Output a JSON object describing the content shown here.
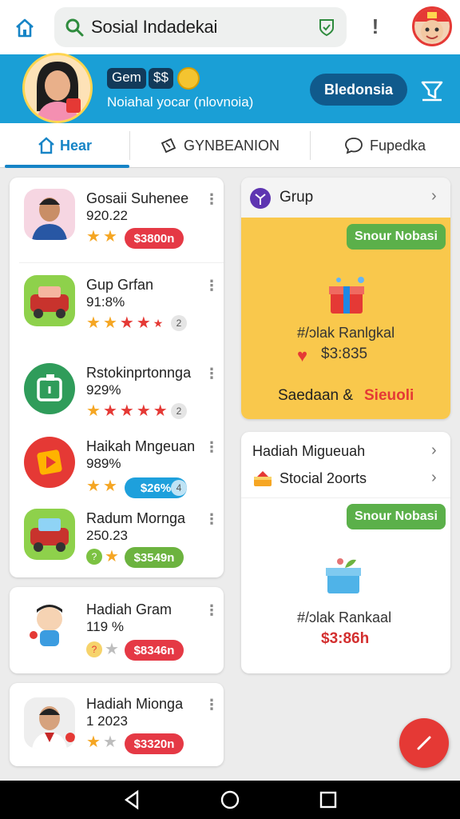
{
  "search": {
    "query": "Sosial Indadekai"
  },
  "banner": {
    "tag1": "Gem",
    "tag2": "$$",
    "subtitle": "Noiahal yocar (nlovnoia)",
    "button_label": "Bledonsia"
  },
  "tabs": [
    {
      "label": "Hear",
      "active": true,
      "icon": "home-icon"
    },
    {
      "label": "GYNBEANION",
      "active": false,
      "icon": "ticket-icon"
    },
    {
      "label": "Fupedka",
      "active": false,
      "icon": "chat-icon"
    }
  ],
  "list_items": [
    {
      "title": "Gosaii Suhenee",
      "subtitle": "920.22",
      "rating": "2 orange stars",
      "price": "$3800n",
      "price_color": "red"
    },
    {
      "title": "Gup Grfan",
      "subtitle": "91:8%",
      "rating": "2 orange, 3 red stars",
      "badge": "2"
    },
    {
      "title": "Rstokinprtonnga",
      "subtitle": "929%",
      "rating": "1 orange, 4 red stars",
      "badge": "2"
    },
    {
      "title": "Haikah Mngeuan",
      "subtitle": "989%",
      "rating": "2 orange stars",
      "price": "$26%",
      "price_color": "blue",
      "badge": "4"
    },
    {
      "title": "Radum Mornga",
      "subtitle": "250.23",
      "rating": "2 orange stars",
      "price": "$3549n",
      "price_color": "green",
      "badge": "?"
    },
    {
      "title": "Hadiah Gram",
      "subtitle": "119 %",
      "rating": "1 gray star",
      "price": "$8346n",
      "price_color": "red",
      "badge": "?"
    },
    {
      "title": "Hadiah Mionga",
      "subtitle": "1 2023",
      "rating": "1 orange, 1 gray star",
      "price": "$3320n",
      "price_color": "red"
    }
  ],
  "right_top_card": {
    "header": "Grup",
    "button": "Snour Nobasi",
    "line1": "#/ɔlak Ranlgkal",
    "price": "$3:835",
    "footer_a": "Saedaan &",
    "footer_b": "Sieuoli"
  },
  "right_bottom_card": {
    "header": "Hadiah Migueuah",
    "row": "Stocial 2oorts",
    "button": "Snour Nobasi",
    "line1": "#/ɔlak Rankaal",
    "price": "$3:86h"
  },
  "colors": {
    "blue": "#1a9fd6",
    "red": "#e53945",
    "green": "#5bb04a",
    "yellow": "#f9c84c"
  }
}
